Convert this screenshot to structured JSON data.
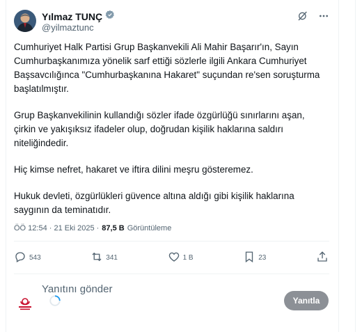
{
  "header": {
    "display_name": "Yılmaz TUNÇ",
    "handle": "@yilmaztunc"
  },
  "tweet": {
    "paragraphs": [
      "Cumhuriyet Halk Partisi Grup Başkanvekili Ali Mahir Başarır'ın, Sayın Cumhurbaşkanımıza yönelik sarf ettiği sözlerle ilgili Ankara Cumhuriyet Başsavcılığınca \"Cumhurbaşkanına Hakaret\" suçundan re'sen soruşturma başlatılmıştır.",
      "Grup Başkanvekilinin kullandığı sözler ifade özgürlüğü sınırlarını aşan, çirkin ve yakışıksız ifadeler olup, doğrudan kişilik haklarına saldırı niteliğindedir.",
      "Hiç kimse nefret, hakaret ve iftira dilini meşru gösteremez.",
      "Hukuk devleti, özgürlükleri güvence altına aldığı gibi kişilik haklarına saygının da teminatıdır."
    ],
    "timestamp": "ÖÖ 12:54 · 21 Eki 2025 ·",
    "views_count": "87,5 B",
    "views_label": "Görüntüleme"
  },
  "actions": {
    "replies": "543",
    "reposts": "341",
    "likes": "1 B",
    "bookmarks": "23"
  },
  "reply": {
    "placeholder": "Yanıtını gönder",
    "button_label": "Yanıtla"
  },
  "colors": {
    "text": "#0f1419",
    "muted": "#536471",
    "verified": "#829aab",
    "reply_button": "#8c9096",
    "spinner": "#1d9bf0"
  }
}
